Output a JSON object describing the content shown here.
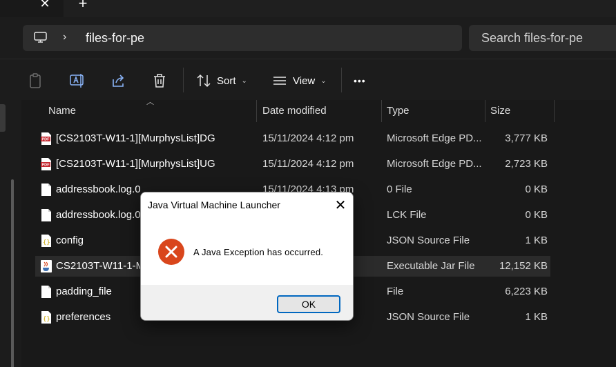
{
  "tabbar": {
    "close_glyph": "✕",
    "new_tab_glyph": "+"
  },
  "address": {
    "chevron": "›",
    "folder": "files-for-pe"
  },
  "search": {
    "placeholder": "Search files-for-pe"
  },
  "toolbar": {
    "sort_label": "Sort",
    "view_label": "View",
    "more_glyph": "•••",
    "chevron": "⌄"
  },
  "columns": {
    "name": "Name",
    "date_modified": "Date modified",
    "type": "Type",
    "size": "Size"
  },
  "files": [
    {
      "name": "[CS2103T-W11-1][MurphysList]DG",
      "date": "15/11/2024 4:12 pm",
      "type": "Microsoft Edge PD...",
      "size": "3,777 KB",
      "icon": "pdf-icon"
    },
    {
      "name": "[CS2103T-W11-1][MurphysList]UG",
      "date": "15/11/2024 4:12 pm",
      "type": "Microsoft Edge PD...",
      "size": "2,723 KB",
      "icon": "pdf-icon"
    },
    {
      "name": "addressbook.log.0",
      "date": "15/11/2024 4:13 pm",
      "type": "0 File",
      "size": "0 KB",
      "icon": "file-icon"
    },
    {
      "name": "addressbook.log.0",
      "date": "",
      "type": "LCK File",
      "size": "0 KB",
      "icon": "file-icon"
    },
    {
      "name": "config",
      "date": "",
      "type": "JSON Source File",
      "size": "1 KB",
      "icon": "json-icon"
    },
    {
      "name": "CS2103T-W11-1-M",
      "date": "",
      "type": "Executable Jar File",
      "size": "12,152 KB",
      "icon": "jar-icon"
    },
    {
      "name": "padding_file",
      "date": "",
      "type": "File",
      "size": "6,223 KB",
      "icon": "file-icon"
    },
    {
      "name": "preferences",
      "date": "",
      "type": "JSON Source File",
      "size": "1 KB",
      "icon": "json-icon"
    }
  ],
  "dialog": {
    "title": "Java Virtual Machine Launcher",
    "close_glyph": "✕",
    "message": "A Java Exception has occurred.",
    "ok_label": "OK"
  },
  "colors": {
    "background": "#191919",
    "dialog_bg": "#f0f0f0",
    "error_red": "#d9461c",
    "ok_border": "#0067c0",
    "pdf_red": "#c4262e"
  }
}
